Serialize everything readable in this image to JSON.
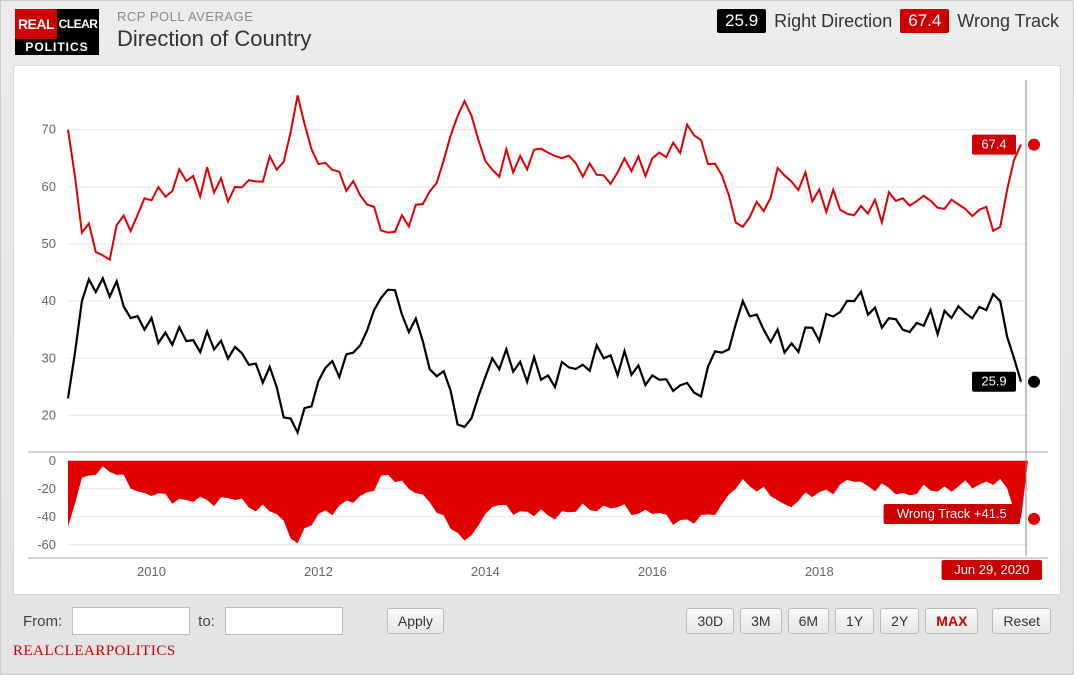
{
  "header": {
    "subtitle": "RCP POLL AVERAGE",
    "title": "Direction of Country",
    "logo": {
      "l1": "REAL",
      "l2": "CLEAR",
      "l3": "POLITICS"
    }
  },
  "legend": {
    "right_val": "25.9",
    "right_label": "Right Direction",
    "wrong_val": "67.4",
    "wrong_label": "Wrong Track"
  },
  "chart_data": {
    "type": "line",
    "title": "Direction of Country — RCP Poll Average",
    "xlabel": "",
    "ylabel": "",
    "x_range": [
      "2009-01",
      "2020-06-29"
    ],
    "y_ticks": [
      20,
      30,
      40,
      50,
      60,
      70
    ],
    "x_ticks": [
      "2010",
      "2012",
      "2014",
      "2016",
      "2018"
    ],
    "series": [
      {
        "name": "Wrong Track",
        "color": "#e00000",
        "start_value": 70,
        "end_value": 67.4,
        "approx_points": [
          {
            "t": "2009-01",
            "v": 70
          },
          {
            "t": "2009-03",
            "v": 52
          },
          {
            "t": "2009-06",
            "v": 48
          },
          {
            "t": "2009-12",
            "v": 58
          },
          {
            "t": "2010-06",
            "v": 61
          },
          {
            "t": "2011-01",
            "v": 60
          },
          {
            "t": "2011-07",
            "v": 63
          },
          {
            "t": "2011-10",
            "v": 76
          },
          {
            "t": "2012-01",
            "v": 64
          },
          {
            "t": "2012-06",
            "v": 61
          },
          {
            "t": "2012-11",
            "v": 52
          },
          {
            "t": "2013-04",
            "v": 57
          },
          {
            "t": "2013-10",
            "v": 75
          },
          {
            "t": "2014-02",
            "v": 63
          },
          {
            "t": "2014-10",
            "v": 66
          },
          {
            "t": "2015-06",
            "v": 62
          },
          {
            "t": "2016-01",
            "v": 65
          },
          {
            "t": "2016-07",
            "v": 69
          },
          {
            "t": "2016-11",
            "v": 62
          },
          {
            "t": "2017-02",
            "v": 53
          },
          {
            "t": "2017-08",
            "v": 62
          },
          {
            "t": "2018-06",
            "v": 55
          },
          {
            "t": "2019-01",
            "v": 58
          },
          {
            "t": "2019-12",
            "v": 56
          },
          {
            "t": "2020-03",
            "v": 53
          },
          {
            "t": "2020-06",
            "v": 67.4
          }
        ]
      },
      {
        "name": "Right Direction",
        "color": "#000000",
        "start_value": 23,
        "end_value": 25.9,
        "approx_points": [
          {
            "t": "2009-01",
            "v": 23
          },
          {
            "t": "2009-03",
            "v": 40
          },
          {
            "t": "2009-06",
            "v": 44
          },
          {
            "t": "2009-12",
            "v": 35
          },
          {
            "t": "2010-06",
            "v": 33
          },
          {
            "t": "2011-01",
            "v": 32
          },
          {
            "t": "2011-07",
            "v": 25
          },
          {
            "t": "2011-10",
            "v": 17
          },
          {
            "t": "2012-01",
            "v": 26
          },
          {
            "t": "2012-06",
            "v": 31
          },
          {
            "t": "2012-11",
            "v": 42
          },
          {
            "t": "2013-04",
            "v": 33
          },
          {
            "t": "2013-10",
            "v": 18
          },
          {
            "t": "2014-02",
            "v": 30
          },
          {
            "t": "2014-10",
            "v": 27
          },
          {
            "t": "2015-06",
            "v": 30
          },
          {
            "t": "2016-01",
            "v": 27
          },
          {
            "t": "2016-07",
            "v": 24
          },
          {
            "t": "2016-11",
            "v": 31
          },
          {
            "t": "2017-02",
            "v": 40
          },
          {
            "t": "2017-08",
            "v": 31
          },
          {
            "t": "2018-06",
            "v": 40
          },
          {
            "t": "2019-01",
            "v": 35
          },
          {
            "t": "2019-12",
            "v": 39
          },
          {
            "t": "2020-03",
            "v": 40
          },
          {
            "t": "2020-06",
            "v": 25.9
          }
        ]
      }
    ],
    "spread": {
      "label": "Wrong Track +41.5",
      "y_ticks": [
        0,
        -20,
        -40,
        -60
      ],
      "end_value": -41.5,
      "approx_points": [
        {
          "t": "2009-01",
          "v": -47
        },
        {
          "t": "2009-03",
          "v": -12
        },
        {
          "t": "2009-06",
          "v": -4
        },
        {
          "t": "2009-12",
          "v": -23
        },
        {
          "t": "2010-06",
          "v": -28
        },
        {
          "t": "2011-01",
          "v": -28
        },
        {
          "t": "2011-07",
          "v": -38
        },
        {
          "t": "2011-10",
          "v": -59
        },
        {
          "t": "2012-01",
          "v": -38
        },
        {
          "t": "2012-06",
          "v": -30
        },
        {
          "t": "2012-11",
          "v": -10
        },
        {
          "t": "2013-04",
          "v": -24
        },
        {
          "t": "2013-10",
          "v": -57
        },
        {
          "t": "2014-02",
          "v": -33
        },
        {
          "t": "2014-10",
          "v": -39
        },
        {
          "t": "2015-06",
          "v": -32
        },
        {
          "t": "2016-01",
          "v": -38
        },
        {
          "t": "2016-07",
          "v": -45
        },
        {
          "t": "2016-11",
          "v": -31
        },
        {
          "t": "2017-02",
          "v": -13
        },
        {
          "t": "2017-08",
          "v": -31
        },
        {
          "t": "2018-06",
          "v": -15
        },
        {
          "t": "2019-01",
          "v": -23
        },
        {
          "t": "2019-12",
          "v": -17
        },
        {
          "t": "2020-03",
          "v": -13
        },
        {
          "t": "2020-06",
          "v": -41.5
        }
      ]
    },
    "cursor_date": "Jun 29, 2020",
    "end_badges": {
      "wrong_track": "67.4",
      "right_direction": "25.9"
    }
  },
  "toolbar": {
    "from_label": "From:",
    "to_label": "to:",
    "apply": "Apply",
    "ranges": [
      "30D",
      "3M",
      "6M",
      "1Y",
      "2Y",
      "MAX"
    ],
    "active_range": "MAX",
    "reset": "Reset",
    "from_value": "",
    "to_value": ""
  },
  "footer": "REALCLEARPOLITICS"
}
